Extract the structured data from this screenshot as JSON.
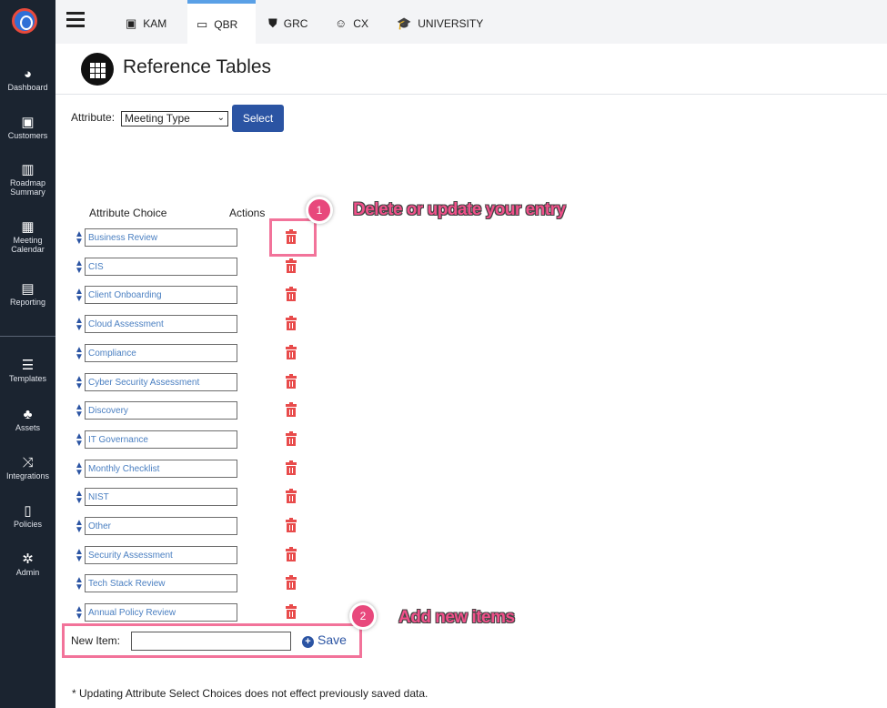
{
  "sidebar": {
    "items": [
      {
        "label": "Dashboard",
        "icon": "palette-icon"
      },
      {
        "label": "Customers",
        "icon": "id-card-icon"
      },
      {
        "label": "Roadmap Summary",
        "icon": "map-icon"
      },
      {
        "label": "Meeting Calendar",
        "icon": "calendar-icon"
      },
      {
        "label": "Reporting",
        "icon": "report-icon"
      },
      {
        "label": "Templates",
        "icon": "server-icon"
      },
      {
        "label": "Assets",
        "icon": "cubes-icon"
      },
      {
        "label": "Integrations",
        "icon": "random-icon"
      },
      {
        "label": "Policies",
        "icon": "file-icon"
      },
      {
        "label": "Admin",
        "icon": "gears-icon"
      }
    ]
  },
  "topbar": {
    "tabs": [
      {
        "label": "KAM",
        "icon": "id-card-icon"
      },
      {
        "label": "QBR",
        "icon": "laptop-icon"
      },
      {
        "label": "GRC",
        "icon": "shield-icon"
      },
      {
        "label": "CX",
        "icon": "smile-icon"
      },
      {
        "label": "UNIVERSITY",
        "icon": "graduation-cap-icon"
      }
    ],
    "active_tab": "QBR"
  },
  "page": {
    "title": "Reference Tables"
  },
  "attribute": {
    "label": "Attribute:",
    "selected": "Meeting Type",
    "select_button": "Select"
  },
  "table": {
    "headers": {
      "choice": "Attribute Choice",
      "actions": "Actions"
    },
    "choices": [
      "Business Review",
      "CIS",
      "Client Onboarding",
      "Cloud Assessment",
      "Compliance",
      "Cyber Security Assessment",
      "Discovery",
      "IT Governance",
      "Monthly Checklist",
      "NIST",
      "Other",
      "Security Assessment",
      "Tech Stack Review",
      "Annual Policy Review"
    ]
  },
  "new_item": {
    "label": "New Item:",
    "value": "",
    "save_label": "Save"
  },
  "annotations": [
    {
      "number": "1",
      "text": "Delete or update your entry"
    },
    {
      "number": "2",
      "text": "Add new items"
    }
  ],
  "footnote": "* Updating Attribute Select Choices does not effect previously saved data.",
  "colors": {
    "sidebar_bg": "#1b2430",
    "accent": "#2b54a3",
    "delete": "#e84b4b",
    "annotation": "#f0508a"
  }
}
